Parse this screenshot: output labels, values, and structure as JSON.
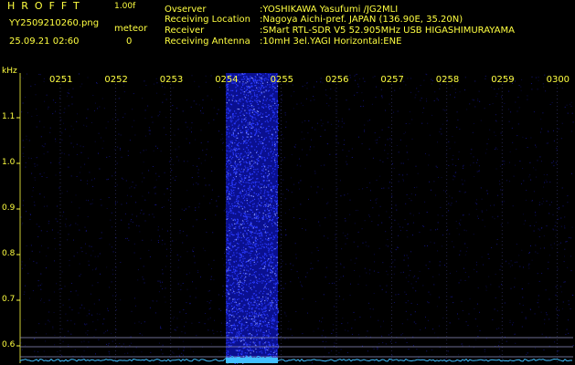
{
  "header": {
    "app_title": "HROFFT",
    "version": "1.00f",
    "filename": "YY2509210260.png",
    "timestamp": "25.09.21 02:60",
    "meteor_label": "meteor",
    "meteor_count": "0"
  },
  "info": [
    {
      "label": "Ovserver",
      "value": ":YOSHIKAWA Yasufumi /JG2MLI"
    },
    {
      "label": "Receiving Location",
      "value": ":Nagoya Aichi-pref. JAPAN (136.90E, 35.20N)"
    },
    {
      "label": "Receiver",
      "value": ":SMart RTL-SDR V5 52.905MHz USB HIGASHIMURAYAMA"
    },
    {
      "label": "Receiving Antenna",
      "value": ":10mH 3el.YAGI Horizontal:ENE"
    }
  ],
  "axis": {
    "unit": "kHz",
    "y_ticks": [
      "1.1",
      "1.0",
      "0.9",
      "0.8",
      "0.7",
      "0.6"
    ],
    "x_ticks": [
      "0251",
      "0252",
      "0253",
      "0254",
      "0255",
      "0256",
      "0257",
      "0258",
      "0259",
      "0300"
    ]
  },
  "colors": {
    "text": "#ffff40",
    "grid": "#3a3a7a",
    "noise": "#1a1aaa",
    "burst": "#2a3aff",
    "baseline": "#40c0ff"
  }
}
